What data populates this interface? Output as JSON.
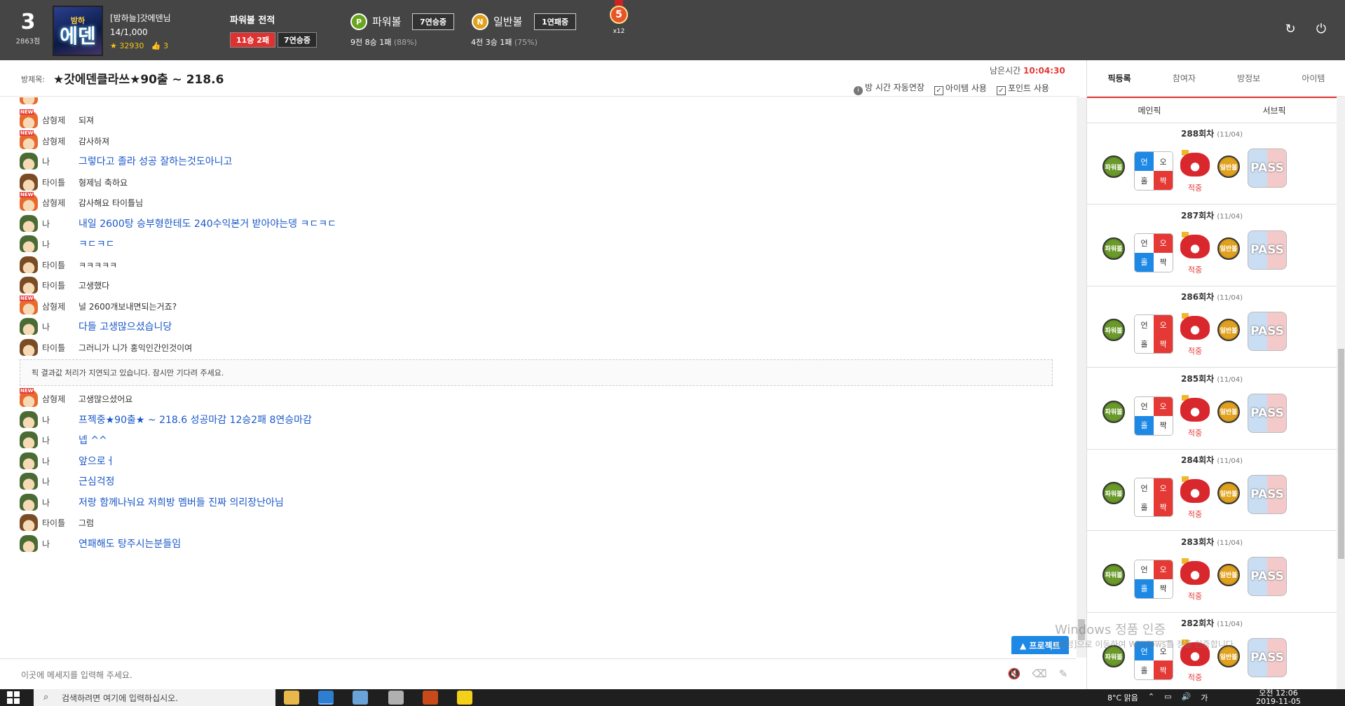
{
  "header": {
    "rank": "3",
    "points": "2863점",
    "avatar_small": "밤하",
    "avatar_big": "에덴",
    "username": "[밤하늘]갓에덴님",
    "level": "14/1,000",
    "coins": "32930",
    "likes": "3",
    "record_title": "파워볼 전적",
    "record_wl": "11승 2패",
    "record_streak": "7연승중",
    "powerball_chip": "P",
    "powerball_label": "파워볼",
    "powerball_streak": "7연승중",
    "powerball_stat": "9전 8승 1패",
    "powerball_pct": "(88%)",
    "normalball_chip": "N",
    "normalball_label": "일반볼",
    "normalball_streak": "1연패중",
    "normalball_stat": "4전 3승 1패",
    "normalball_pct": "(75%)",
    "medal_num": "5",
    "medal_mult": "x12",
    "refresh_icon": "refresh-icon",
    "power_icon": "power-icon"
  },
  "room": {
    "label": "방제목:",
    "title": "★갓에덴클라쓰★90출 ~ 218.6",
    "remain_label": "남은시간",
    "remain_time": "10:04:30",
    "opt_autoext": "방 시간 자동연장",
    "opt_item": "아이템 사용",
    "opt_point": "포인트 사용"
  },
  "chat": {
    "messages": [
      {
        "nick": "삼형제",
        "text": "되져",
        "face": "newb",
        "me": false
      },
      {
        "nick": "삼형제",
        "text": "감사하져",
        "face": "newb",
        "me": false
      },
      {
        "nick": "나",
        "text": "그렇다고 졸라 성공 잘하는것도아니고",
        "face": "army",
        "me": true
      },
      {
        "nick": "타이틀",
        "text": "형제님 축하요",
        "face": "brown",
        "me": false
      },
      {
        "nick": "삼형제",
        "text": "감사해요 타이틀님",
        "face": "newb",
        "me": false
      },
      {
        "nick": "나",
        "text": "내일 2600탕 승부형한테도 240수익본거 받아야는뎅 ㅋㄷㅋㄷ",
        "face": "army",
        "me": true
      },
      {
        "nick": "나",
        "text": "ㅋㄷㅋㄷ",
        "face": "army",
        "me": true
      },
      {
        "nick": "타이틀",
        "text": "ㅋㅋㅋㅋㅋ",
        "face": "brown",
        "me": false
      },
      {
        "nick": "타이틀",
        "text": "고생했다",
        "face": "brown",
        "me": false
      },
      {
        "nick": "삼형제",
        "text": "널 2600개보내면되는거죠?",
        "face": "newb",
        "me": false
      },
      {
        "nick": "나",
        "text": "다들 고생많으셨습니당",
        "face": "army",
        "me": true
      },
      {
        "nick": "타이틀",
        "text": "그러니가 니가 홍익인간인것이여",
        "face": "brown",
        "me": false
      }
    ],
    "system_notice": "픽 결과값 처리가 지연되고 있습니다. 잠시만 기다려 주세요.",
    "messages2": [
      {
        "nick": "삼형제",
        "text": "고생많으셨어요",
        "face": "newb",
        "me": false
      },
      {
        "nick": "나",
        "text": "프젝중★90출★ ~ 218.6 성공마감 12승2패 8연승마감",
        "face": "army",
        "me": true
      },
      {
        "nick": "나",
        "text": "넵 ^^",
        "face": "army",
        "me": true
      },
      {
        "nick": "나",
        "text": "앞으로ㅓ",
        "face": "army",
        "me": true
      },
      {
        "nick": "나",
        "text": "근심걱정",
        "face": "army",
        "me": true
      },
      {
        "nick": "나",
        "text": "저랑 함께나눠요 저희방 멤버들 진짜 의리장난아님",
        "face": "army",
        "me": true
      },
      {
        "nick": "타이틀",
        "text": "그럼",
        "face": "brown",
        "me": false
      },
      {
        "nick": "나",
        "text": "연패해도 탕주시는분들임",
        "face": "army",
        "me": true
      }
    ],
    "protect_label": "▲ 프로젝트",
    "input_placeholder": "이곳에 메세지를 입력해 주세요."
  },
  "right_panel": {
    "tabs": [
      "픽등록",
      "참여자",
      "방정보",
      "아이템"
    ],
    "subtabs": [
      "메인픽",
      "서브픽"
    ],
    "power_label": "파워볼",
    "normal_label": "일반볼",
    "pass_label": "PASS",
    "rounds": [
      {
        "title": "288회차",
        "date": "(11/04)",
        "cells": [
          "언",
          "오",
          "홀",
          "짝"
        ],
        "hl": [
          "b",
          "",
          "",
          "r"
        ],
        "result": "적중"
      },
      {
        "title": "287회차",
        "date": "(11/04)",
        "cells": [
          "언",
          "오",
          "홀",
          "짝"
        ],
        "hl": [
          "",
          "r",
          "b",
          ""
        ],
        "result": "적중"
      },
      {
        "title": "286회차",
        "date": "(11/04)",
        "cells": [
          "언",
          "오",
          "홀",
          "짝"
        ],
        "hl": [
          "",
          "r",
          "",
          "r"
        ],
        "result": "적중"
      },
      {
        "title": "285회차",
        "date": "(11/04)",
        "cells": [
          "언",
          "오",
          "홀",
          "짝"
        ],
        "hl": [
          "",
          "r",
          "b",
          ""
        ],
        "result": "적중"
      },
      {
        "title": "284회차",
        "date": "(11/04)",
        "cells": [
          "언",
          "오",
          "홀",
          "짝"
        ],
        "hl": [
          "",
          "r",
          "",
          "r"
        ],
        "result": "적중"
      },
      {
        "title": "283회차",
        "date": "(11/04)",
        "cells": [
          "언",
          "오",
          "홀",
          "짝"
        ],
        "hl": [
          "",
          "r",
          "b",
          ""
        ],
        "result": "적중"
      },
      {
        "title": "282회차",
        "date": "(11/04)",
        "cells": [
          "언",
          "오",
          "홀",
          "짝"
        ],
        "hl": [
          "b",
          "",
          "",
          "r"
        ],
        "result": "적중"
      }
    ]
  },
  "watermark": {
    "line1": "Windows 정품 인증",
    "line2": "[설정]으로 이동하여 Windows를 정품 인증합니다."
  },
  "taskbar": {
    "search_placeholder": "검색하려면 여기에 입력하십시오.",
    "weather": "8°C 맑음",
    "lang": "가",
    "time": "오전 12:06",
    "date": "2019-11-05"
  },
  "colors": {
    "topbar_bg": "#454545",
    "accent_red": "#e53935",
    "accent_blue": "#1e88e5",
    "me_text": "#1a57c9"
  }
}
